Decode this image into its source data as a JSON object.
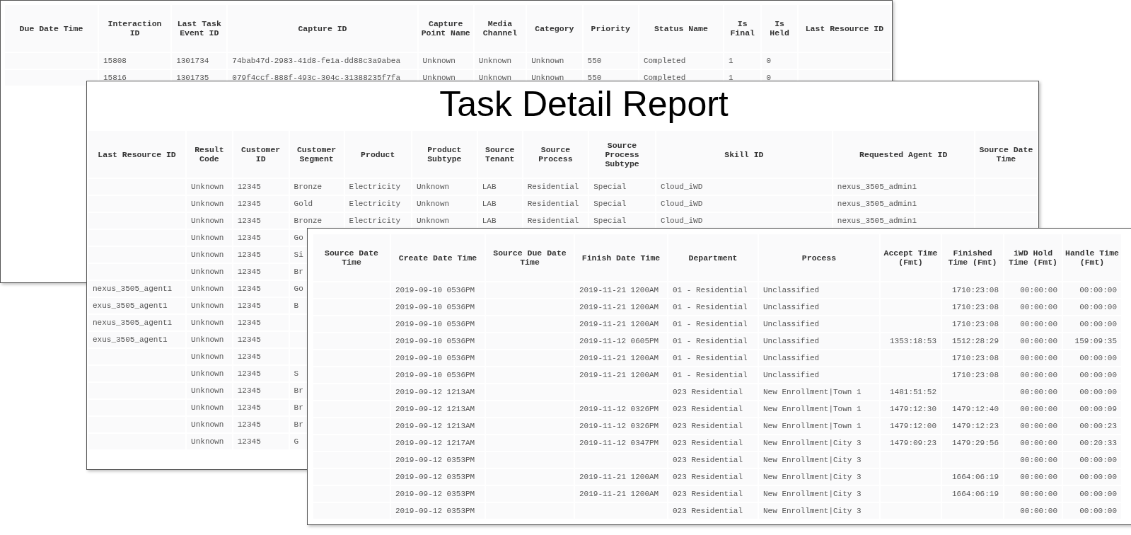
{
  "sheets": [
    {
      "columns": [
        "Due Date Time",
        "Interaction ID",
        "Last Task Event ID",
        "Capture ID",
        "Capture Point Name",
        "Media Channel",
        "Category",
        "Priority",
        "Status Name",
        "Is Final",
        "Is Held",
        "Last Resource ID"
      ],
      "rows": [
        [
          "",
          "15808",
          "1301734",
          "74bab47d-2983-41d8-fe1a-dd88c3a9abea",
          "Unknown",
          "Unknown",
          "Unknown",
          "550",
          "Completed",
          "1",
          "0",
          ""
        ],
        [
          "",
          "15816",
          "1301735",
          "079f4ccf-888f-493c-304c-31388235f7fa",
          "Unknown",
          "Unknown",
          "Unknown",
          "550",
          "Completed",
          "1",
          "0",
          ""
        ]
      ]
    },
    {
      "title": "Task Detail Report",
      "columns": [
        "Last Resource ID",
        "Result Code",
        "Customer ID",
        "Customer Segment",
        "Product",
        "Product Subtype",
        "Source Tenant",
        "Source Process",
        "Source Process Subtype",
        "Skill ID",
        "Requested Agent ID",
        "Source Date Time"
      ],
      "rows": [
        [
          "",
          "Unknown",
          "12345",
          "Bronze",
          "Electricity",
          "Unknown",
          "LAB",
          "Residential",
          "Special",
          "Cloud_iWD",
          "nexus_3505_admin1",
          ""
        ],
        [
          "",
          "Unknown",
          "12345",
          "Gold",
          "Electricity",
          "Unknown",
          "LAB",
          "Residential",
          "Special",
          "Cloud_iWD",
          "nexus_3505_admin1",
          ""
        ],
        [
          "",
          "Unknown",
          "12345",
          "Bronze",
          "Electricity",
          "Unknown",
          "LAB",
          "Residential",
          "Special",
          "Cloud_iWD",
          "nexus_3505_admin1",
          ""
        ],
        [
          "",
          "Unknown",
          "12345",
          "Go"
        ],
        [
          "",
          "Unknown",
          "12345",
          "Si"
        ],
        [
          "",
          "Unknown",
          "12345",
          "Br"
        ],
        [
          "nexus_3505_agent1",
          "Unknown",
          "12345",
          "Go"
        ],
        [
          "exus_3505_agent1",
          "Unknown",
          "12345",
          "B"
        ],
        [
          "nexus_3505_agent1",
          "Unknown",
          "12345",
          ""
        ],
        [
          "exus_3505_agent1",
          "Unknown",
          "12345",
          ""
        ],
        [
          "",
          "Unknown",
          "12345",
          ""
        ],
        [
          "",
          "Unknown",
          "12345",
          "S"
        ],
        [
          "",
          "Unknown",
          "12345",
          "Br"
        ],
        [
          "",
          "Unknown",
          "12345",
          "Br"
        ],
        [
          "",
          "Unknown",
          "12345",
          "Br"
        ],
        [
          "",
          "Unknown",
          "12345",
          "G"
        ]
      ]
    },
    {
      "columns": [
        "Source Date Time",
        "Create Date Time",
        "Source Due Date Time",
        "Finish Date Time",
        "Department",
        "Process",
        "Accept Time (Fmt)",
        "Finished Time (Fmt)",
        "iWD Hold Time (Fmt)",
        "Handle Time (Fmt)"
      ],
      "rows": [
        [
          "",
          "2019-09-10 0536PM",
          "",
          "2019-11-21 1200AM",
          "01 - Residential",
          "Unclassified",
          "",
          "1710:23:08",
          "00:00:00",
          "00:00:00"
        ],
        [
          "",
          "2019-09-10 0536PM",
          "",
          "2019-11-21 1200AM",
          "01 - Residential",
          "Unclassified",
          "",
          "1710:23:08",
          "00:00:00",
          "00:00:00"
        ],
        [
          "",
          "2019-09-10 0536PM",
          "",
          "2019-11-21 1200AM",
          "01 - Residential",
          "Unclassified",
          "",
          "1710:23:08",
          "00:00:00",
          "00:00:00"
        ],
        [
          "",
          "2019-09-10 0536PM",
          "",
          "2019-11-12 0605PM",
          "01 - Residential",
          "Unclassified",
          "1353:18:53",
          "1512:28:29",
          "00:00:00",
          "159:09:35"
        ],
        [
          "",
          "2019-09-10 0536PM",
          "",
          "2019-11-21 1200AM",
          "01 - Residential",
          "Unclassified",
          "",
          "1710:23:08",
          "00:00:00",
          "00:00:00"
        ],
        [
          "",
          "2019-09-10 0536PM",
          "",
          "2019-11-21 1200AM",
          "01 - Residential",
          "Unclassified",
          "",
          "1710:23:08",
          "00:00:00",
          "00:00:00"
        ],
        [
          "",
          "2019-09-12 1213AM",
          "",
          "",
          "023 Residential",
          "New Enrollment|Town 1",
          "1481:51:52",
          "",
          "00:00:00",
          "00:00:00"
        ],
        [
          "",
          "2019-09-12 1213AM",
          "",
          "2019-11-12 0326PM",
          "023 Residential",
          "New Enrollment|Town 1",
          "1479:12:30",
          "1479:12:40",
          "00:00:00",
          "00:00:09"
        ],
        [
          "",
          "2019-09-12 1213AM",
          "",
          "2019-11-12 0326PM",
          "023 Residential",
          "New Enrollment|Town 1",
          "1479:12:00",
          "1479:12:23",
          "00:00:00",
          "00:00:23"
        ],
        [
          "",
          "2019-09-12 1217AM",
          "",
          "2019-11-12 0347PM",
          "023 Residential",
          "New Enrollment|City 3",
          "1479:09:23",
          "1479:29:56",
          "00:00:00",
          "00:20:33"
        ],
        [
          "",
          "2019-09-12 0353PM",
          "",
          "",
          "023 Residential",
          "New Enrollment|City 3",
          "",
          "",
          "00:00:00",
          "00:00:00"
        ],
        [
          "",
          "2019-09-12 0353PM",
          "",
          "2019-11-21 1200AM",
          "023 Residential",
          "New Enrollment|City 3",
          "",
          "1664:06:19",
          "00:00:00",
          "00:00:00"
        ],
        [
          "",
          "2019-09-12 0353PM",
          "",
          "2019-11-21 1200AM",
          "023 Residential",
          "New Enrollment|City 3",
          "",
          "1664:06:19",
          "00:00:00",
          "00:00:00"
        ],
        [
          "",
          "2019-09-12 0353PM",
          "",
          "",
          "023 Residential",
          "New Enrollment|City 3",
          "",
          "",
          "00:00:00",
          "00:00:00"
        ]
      ]
    }
  ]
}
